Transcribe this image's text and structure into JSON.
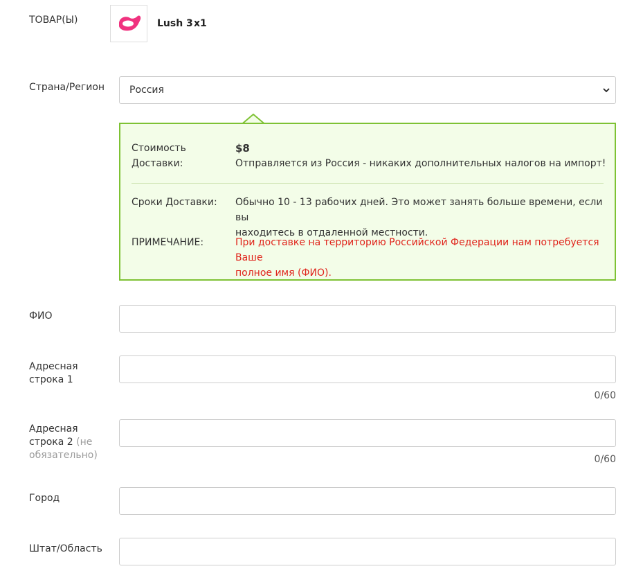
{
  "product": {
    "section_label": "ТОВАР(Ы)",
    "name": "Lush 3",
    "quantity": "x1",
    "thumb_icon": "lush-product-icon",
    "thumb_color": "#f0327f"
  },
  "country": {
    "label": "Страна/Регион",
    "selected": "Россия",
    "chevron_icon": "chevron-down-icon"
  },
  "shipping": {
    "cost_label_line1": "Стоимость",
    "cost_label_line2": "Доставки:",
    "price": "$8",
    "ship_note": "Отправляется из Россия - никаких дополнительных налогов на импорт!",
    "time_label": "Сроки Доставки:",
    "time_line1": "Обычно 10 - 13 рабочих дней. Это может занять больше времени, если вы",
    "time_line2": "находитесь в отдаленной местности.",
    "note_label": "ПРИМЕЧАНИЕ:",
    "note_line1": "При доставке на территорию Российской Федерации нам потребуется Ваше",
    "note_line2": "полное имя (ФИО).",
    "border_color": "#7ec234",
    "background_color": "#f3fde8",
    "note_color": "#e0241b"
  },
  "form": {
    "full_name_label": "ФИО",
    "address1_label_line1": "Адресная",
    "address1_label_line2": "строка 1",
    "address1_counter": "0/60",
    "address2_label_line1": "Адресная",
    "address2_label_line2": "строка 2",
    "address2_optional_line1": "(не",
    "address2_optional_line2": "обязательно)",
    "address2_counter": "0/60",
    "city_label": "Город",
    "state_label": "Штат/Область"
  }
}
